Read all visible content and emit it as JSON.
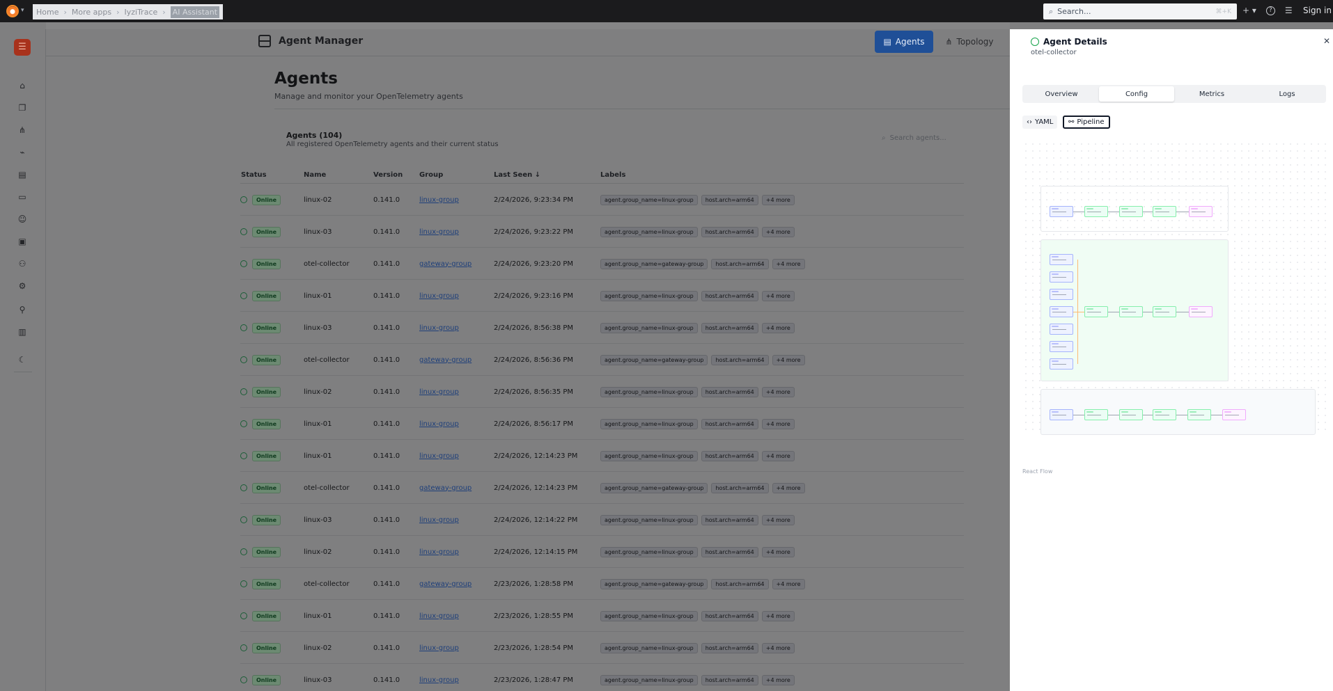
{
  "topbar": {
    "breadcrumbs": [
      "Home",
      "More apps",
      "IyziTrace",
      "AI Assistant"
    ],
    "search_placeholder": "Search...",
    "search_shortcut": "⌘+K",
    "sign_in": "Sign in"
  },
  "header": {
    "app_title": "Agent Manager",
    "nav": {
      "agents": "Agents",
      "topology": "Topology"
    }
  },
  "page": {
    "title": "Agents",
    "subtitle": "Manage and monitor your OpenTelemetry agents"
  },
  "agents_card": {
    "title": "Agents (104)",
    "subtitle": "All registered OpenTelemetry agents and their current status",
    "search_placeholder": "Search agents...",
    "columns": [
      "Status",
      "Name",
      "Version",
      "Group",
      "Last Seen",
      "Labels"
    ],
    "rows": [
      {
        "status": "Online",
        "name": "linux-02",
        "version": "0.141.0",
        "group": "linux-group",
        "last_seen": "2/24/2026, 9:23:34 PM",
        "labels": [
          "agent.group_name=linux-group",
          "host.arch=arm64",
          "+4 more"
        ]
      },
      {
        "status": "Online",
        "name": "linux-03",
        "version": "0.141.0",
        "group": "linux-group",
        "last_seen": "2/24/2026, 9:23:22 PM",
        "labels": [
          "agent.group_name=linux-group",
          "host.arch=arm64",
          "+4 more"
        ]
      },
      {
        "status": "Online",
        "name": "otel-collector",
        "version": "0.141.0",
        "group": "gateway-group",
        "last_seen": "2/24/2026, 9:23:20 PM",
        "labels": [
          "agent.group_name=gateway-group",
          "host.arch=arm64",
          "+4 more"
        ]
      },
      {
        "status": "Online",
        "name": "linux-01",
        "version": "0.141.0",
        "group": "linux-group",
        "last_seen": "2/24/2026, 9:23:16 PM",
        "labels": [
          "agent.group_name=linux-group",
          "host.arch=arm64",
          "+4 more"
        ]
      },
      {
        "status": "Online",
        "name": "linux-03",
        "version": "0.141.0",
        "group": "linux-group",
        "last_seen": "2/24/2026, 8:56:38 PM",
        "labels": [
          "agent.group_name=linux-group",
          "host.arch=arm64",
          "+4 more"
        ]
      },
      {
        "status": "Online",
        "name": "otel-collector",
        "version": "0.141.0",
        "group": "gateway-group",
        "last_seen": "2/24/2026, 8:56:36 PM",
        "labels": [
          "agent.group_name=gateway-group",
          "host.arch=arm64",
          "+4 more"
        ]
      },
      {
        "status": "Online",
        "name": "linux-02",
        "version": "0.141.0",
        "group": "linux-group",
        "last_seen": "2/24/2026, 8:56:35 PM",
        "labels": [
          "agent.group_name=linux-group",
          "host.arch=arm64",
          "+4 more"
        ]
      },
      {
        "status": "Online",
        "name": "linux-01",
        "version": "0.141.0",
        "group": "linux-group",
        "last_seen": "2/24/2026, 8:56:17 PM",
        "labels": [
          "agent.group_name=linux-group",
          "host.arch=arm64",
          "+4 more"
        ]
      },
      {
        "status": "Online",
        "name": "linux-01",
        "version": "0.141.0",
        "group": "linux-group",
        "last_seen": "2/24/2026, 12:14:23 PM",
        "labels": [
          "agent.group_name=linux-group",
          "host.arch=arm64",
          "+4 more"
        ]
      },
      {
        "status": "Online",
        "name": "otel-collector",
        "version": "0.141.0",
        "group": "gateway-group",
        "last_seen": "2/24/2026, 12:14:23 PM",
        "labels": [
          "agent.group_name=gateway-group",
          "host.arch=arm64",
          "+4 more"
        ]
      },
      {
        "status": "Online",
        "name": "linux-03",
        "version": "0.141.0",
        "group": "linux-group",
        "last_seen": "2/24/2026, 12:14:22 PM",
        "labels": [
          "agent.group_name=linux-group",
          "host.arch=arm64",
          "+4 more"
        ]
      },
      {
        "status": "Online",
        "name": "linux-02",
        "version": "0.141.0",
        "group": "linux-group",
        "last_seen": "2/24/2026, 12:14:15 PM",
        "labels": [
          "agent.group_name=linux-group",
          "host.arch=arm64",
          "+4 more"
        ]
      },
      {
        "status": "Online",
        "name": "otel-collector",
        "version": "0.141.0",
        "group": "gateway-group",
        "last_seen": "2/23/2026, 1:28:58 PM",
        "labels": [
          "agent.group_name=gateway-group",
          "host.arch=arm64",
          "+4 more"
        ]
      },
      {
        "status": "Online",
        "name": "linux-01",
        "version": "0.141.0",
        "group": "linux-group",
        "last_seen": "2/23/2026, 1:28:55 PM",
        "labels": [
          "agent.group_name=linux-group",
          "host.arch=arm64",
          "+4 more"
        ]
      },
      {
        "status": "Online",
        "name": "linux-02",
        "version": "0.141.0",
        "group": "linux-group",
        "last_seen": "2/23/2026, 1:28:54 PM",
        "labels": [
          "agent.group_name=linux-group",
          "host.arch=arm64",
          "+4 more"
        ]
      },
      {
        "status": "Online",
        "name": "linux-03",
        "version": "0.141.0",
        "group": "linux-group",
        "last_seen": "2/23/2026, 1:28:47 PM",
        "labels": [
          "agent.group_name=linux-group",
          "host.arch=arm64",
          "+4 more"
        ]
      }
    ]
  },
  "details_panel": {
    "title": "Agent Details",
    "agent_name": "otel-collector",
    "tabs": [
      "Overview",
      "Config",
      "Metrics",
      "Logs"
    ],
    "active_tab": "Config",
    "modes": {
      "yaml": "YAML",
      "pipeline": "Pipeline"
    },
    "active_mode": "Pipeline",
    "attribution": "React Flow"
  },
  "colors": {
    "topbar_bg": "#1b1b1d",
    "accent_blue": "#1f4f97",
    "online_green": "#16a34a",
    "brand_orange": "#f57c2a"
  },
  "icons": {
    "rail": [
      "menu-icon",
      "home-icon",
      "layers-icon",
      "topology-icon",
      "chart-icon",
      "report-icon",
      "document-icon",
      "robot-icon",
      "book-icon",
      "users-icon",
      "settings-icon",
      "link-icon",
      "building-icon",
      "moon-icon"
    ]
  }
}
